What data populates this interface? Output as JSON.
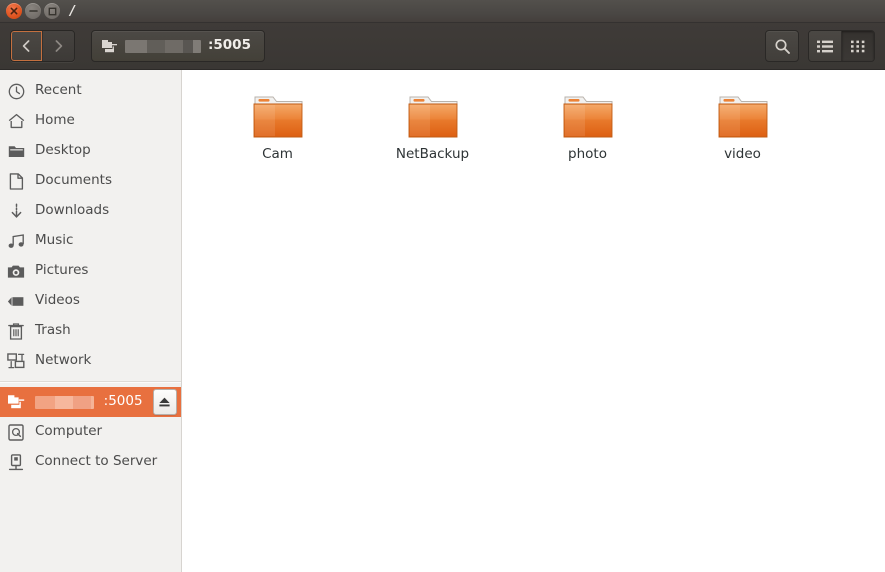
{
  "window": {
    "title": "/",
    "controls": [
      {
        "name": "close",
        "glyph": "close-icon"
      },
      {
        "name": "minimize",
        "glyph": "minimize-icon"
      },
      {
        "name": "maximize",
        "glyph": "maximize-icon"
      }
    ]
  },
  "toolbar": {
    "back_label": "Back",
    "forward_label": "Forward",
    "pathbar": {
      "icon": "server-icon",
      "host_redacted": true,
      "port_text": ":5005"
    },
    "search_label": "Search",
    "list_view_label": "List view",
    "icon_view_label": "Icon view",
    "active_view": "icon-view"
  },
  "sidebar": {
    "items": [
      {
        "label": "Recent",
        "icon": "clock-icon"
      },
      {
        "label": "Home",
        "icon": "home-icon"
      },
      {
        "label": "Desktop",
        "icon": "folder-icon"
      },
      {
        "label": "Documents",
        "icon": "document-icon"
      },
      {
        "label": "Downloads",
        "icon": "download-icon"
      },
      {
        "label": "Music",
        "icon": "music-icon"
      },
      {
        "label": "Pictures",
        "icon": "camera-icon"
      },
      {
        "label": "Videos",
        "icon": "video-icon"
      },
      {
        "label": "Trash",
        "icon": "trash-icon"
      },
      {
        "label": "Network",
        "icon": "network-icon"
      }
    ],
    "mounted": {
      "label_port": ":5005",
      "host_redacted": true,
      "icon": "server-icon",
      "eject_label": "Eject",
      "selected": true
    },
    "bottom_items": [
      {
        "label": "Computer",
        "icon": "computer-icon"
      },
      {
        "label": "Connect to Server",
        "icon": "connect-server-icon"
      }
    ]
  },
  "content": {
    "files": [
      {
        "name": "Cam",
        "type": "folder"
      },
      {
        "name": "NetBackup",
        "type": "folder"
      },
      {
        "name": "photo",
        "type": "folder"
      },
      {
        "name": "video",
        "type": "folder"
      }
    ]
  },
  "colors": {
    "titlebar": "#4a4744",
    "toolbar": "#3c3936",
    "sidebar_bg": "#f2f1ef",
    "selection_orange": "#e8703f",
    "folder_orange": "#e8762c",
    "content_bg": "#ffffff",
    "text_dark": "#4b4b4b"
  }
}
